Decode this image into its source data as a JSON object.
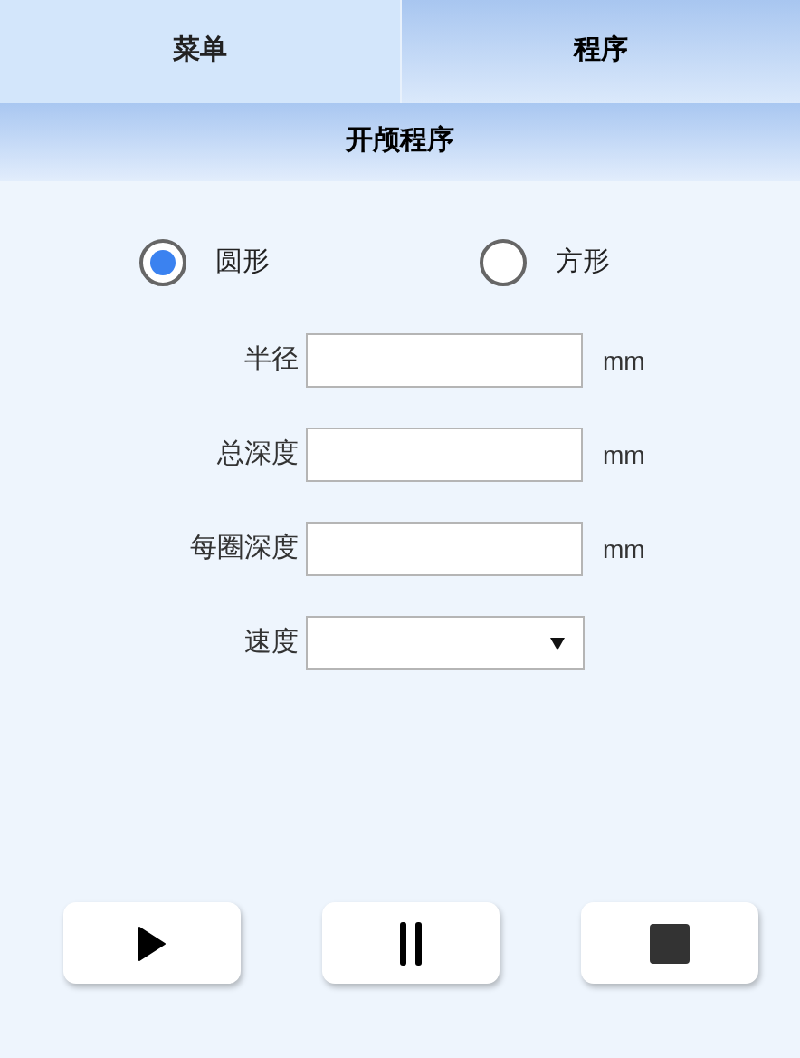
{
  "tabs": [
    {
      "label": "菜单",
      "selected": false
    },
    {
      "label": "程序",
      "selected": true
    }
  ],
  "header": {
    "title": "开颅程序"
  },
  "shape_options": [
    {
      "label": "圆形",
      "selected": true
    },
    {
      "label": "方形",
      "selected": false
    }
  ],
  "fields": [
    {
      "kind": "input",
      "label": "半径",
      "unit": "mm"
    },
    {
      "kind": "input",
      "label": "总深度",
      "unit": "mm"
    },
    {
      "kind": "input",
      "label": "每圈深度",
      "unit": "mm"
    },
    {
      "kind": "select",
      "label": "速度"
    }
  ],
  "buttons": [
    {
      "kind": "play"
    },
    {
      "kind": "pause"
    },
    {
      "kind": "stop"
    }
  ]
}
